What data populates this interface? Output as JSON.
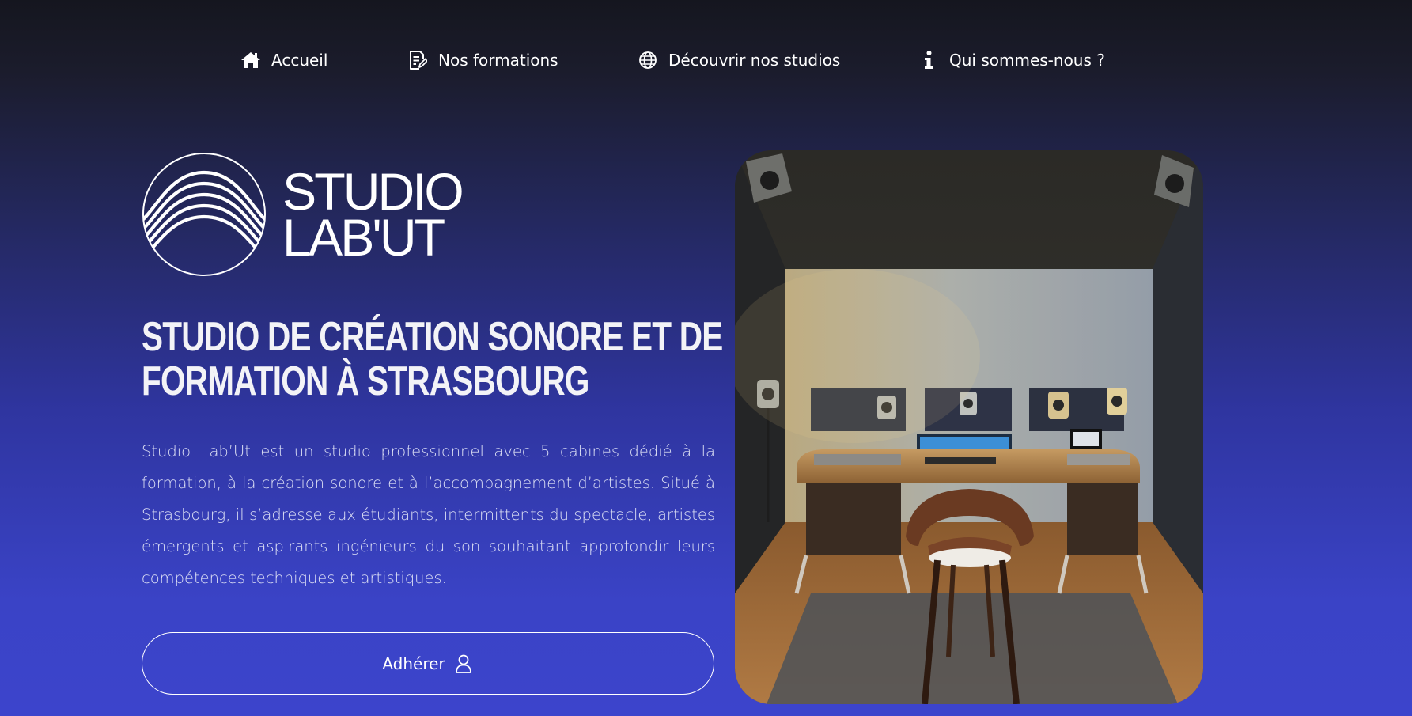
{
  "nav": {
    "items": [
      {
        "label": "Accueil",
        "icon": "home-icon"
      },
      {
        "label": "Nos formations",
        "icon": "document-edit-icon"
      },
      {
        "label": "Découvrir nos studios",
        "icon": "globe-icon"
      },
      {
        "label": "Qui sommes-nous ?",
        "icon": "info-icon"
      }
    ]
  },
  "logo": {
    "line1": "STUDIO",
    "line2": "LAB'UT"
  },
  "hero": {
    "heading_line1": "STUDIO DE CRÉATION SONORE ET DE",
    "heading_line2": "FORMATION À STRASBOURG",
    "description": "Studio Lab’Ut est un studio professionnel avec 5 cabines dédié à la formation, à la création sonore et à l’accompagnement d’artistes. Situé à Strasbourg, il s’adresse aux étudiants, intermittents du spectacle, artistes émergents et aspirants ingénieurs du son souhaitant approfondir leurs compétences techniques et artistiques.",
    "cta_label": "Adhérer",
    "cta_icon": "user-icon"
  },
  "photo": {
    "subject": "studio-control-room"
  },
  "colors": {
    "background_top": "#15161f",
    "background_bottom": "#3c44cc",
    "text": "#ffffff",
    "text_muted": "#dde0f5"
  }
}
